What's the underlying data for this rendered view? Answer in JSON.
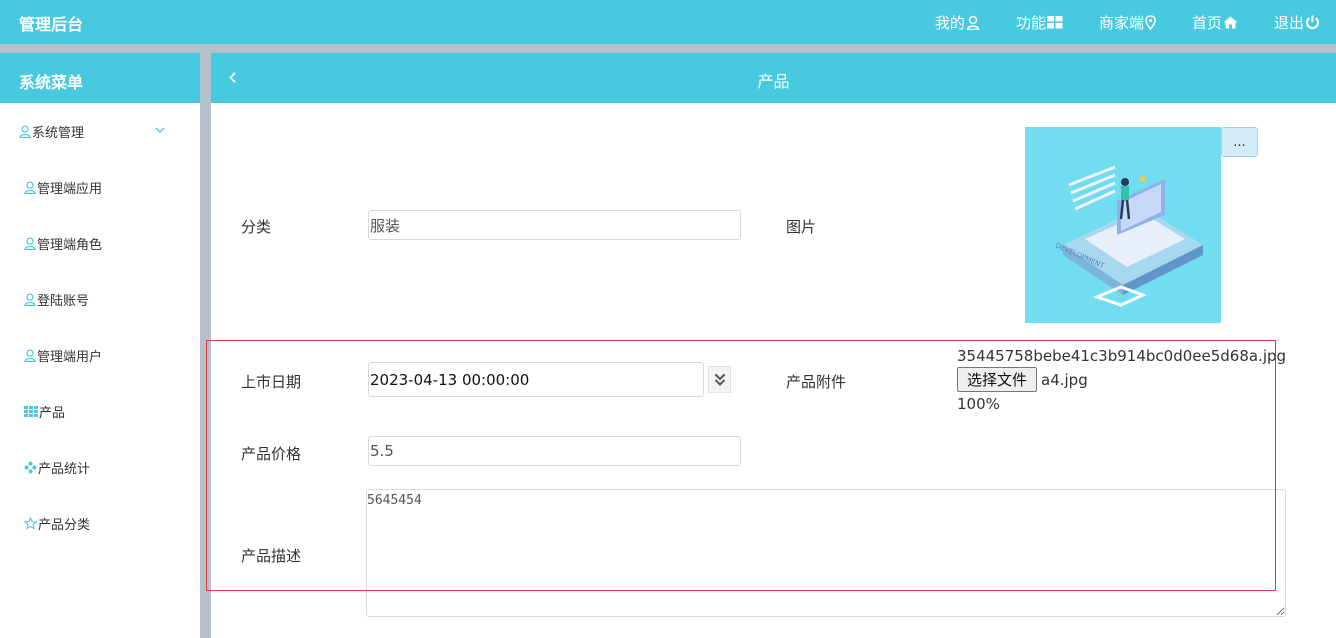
{
  "app": {
    "title": "管理后台"
  },
  "topnav": [
    {
      "label": "我的",
      "icon": "user-icon"
    },
    {
      "label": "功能",
      "icon": "grid-icon"
    },
    {
      "label": "商家端",
      "icon": "map-pin-icon"
    },
    {
      "label": "首页",
      "icon": "home-icon"
    },
    {
      "label": "退出",
      "icon": "power-icon"
    }
  ],
  "sidebar": {
    "title": "系统菜单",
    "group": {
      "label": "系统管理",
      "icon": "user-icon",
      "expand_icon": "chevron-down-icon"
    },
    "items": [
      {
        "label": "管理端应用",
        "icon": "user-icon"
      },
      {
        "label": "管理端角色",
        "icon": "user-icon"
      },
      {
        "label": "登陆账号",
        "icon": "user-icon"
      },
      {
        "label": "管理端用户",
        "icon": "user-icon"
      },
      {
        "label": "产品",
        "icon": "grid-icon"
      },
      {
        "label": "产品统计",
        "icon": "flower-icon"
      },
      {
        "label": "产品分类",
        "icon": "star-icon"
      }
    ]
  },
  "header": {
    "title": "产品",
    "back_icon": "chevron-left-icon"
  },
  "form": {
    "category": {
      "label": "分类",
      "value": "服装"
    },
    "image": {
      "label": "图片",
      "more_label": "..."
    },
    "release_date": {
      "label": "上市日期",
      "value": "2023-04-13 00:00:00",
      "toggle_icon": "double-chevron-down-icon"
    },
    "attachment": {
      "label": "产品附件",
      "current_file": "35445758bebe41c3b914bc0d0ee5d68a.jpg",
      "button_label": "选择文件",
      "selected_file": "a4.jpg",
      "progress": "100%"
    },
    "price": {
      "label": "产品价格",
      "value": "5.5"
    },
    "description": {
      "label": "产品描述",
      "value": "5645454"
    }
  },
  "colors": {
    "accent": "#47c9e0",
    "band": "#b5c2ce",
    "highlight": "#d93a3a",
    "icon": "#47c9e0"
  }
}
